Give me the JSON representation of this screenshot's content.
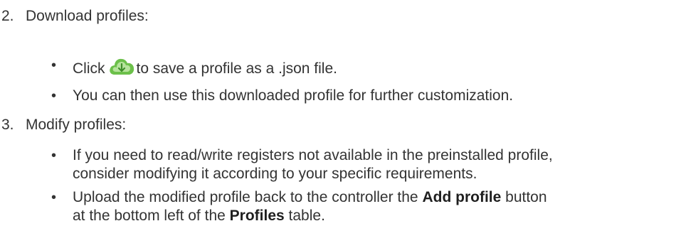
{
  "step2": {
    "number": "2.",
    "title": "Download profiles:",
    "bullet1": {
      "before_icon": "Click",
      "icon": "cloud-download-icon",
      "after_icon": "to save a profile as a .json file."
    },
    "bullet2": "You can then use this downloaded profile for further customization."
  },
  "step3": {
    "number": "3.",
    "title": "Modify profiles:",
    "bullet1": {
      "line1": "If you need to read/write registers not available in the preinstalled profile,",
      "line2": "consider modifying it according to your specific requirements."
    },
    "bullet2": {
      "part1": "Upload the modified profile back to the controller the",
      "bold1": "Add profile",
      "part2": "button",
      "part3": "at the bottom left of the",
      "bold2": "Profiles",
      "part4": "table."
    }
  },
  "bullet_char": "•",
  "colors": {
    "text": "#333333",
    "icon_green": "#6cc04a",
    "icon_light": "#b6e39c"
  }
}
